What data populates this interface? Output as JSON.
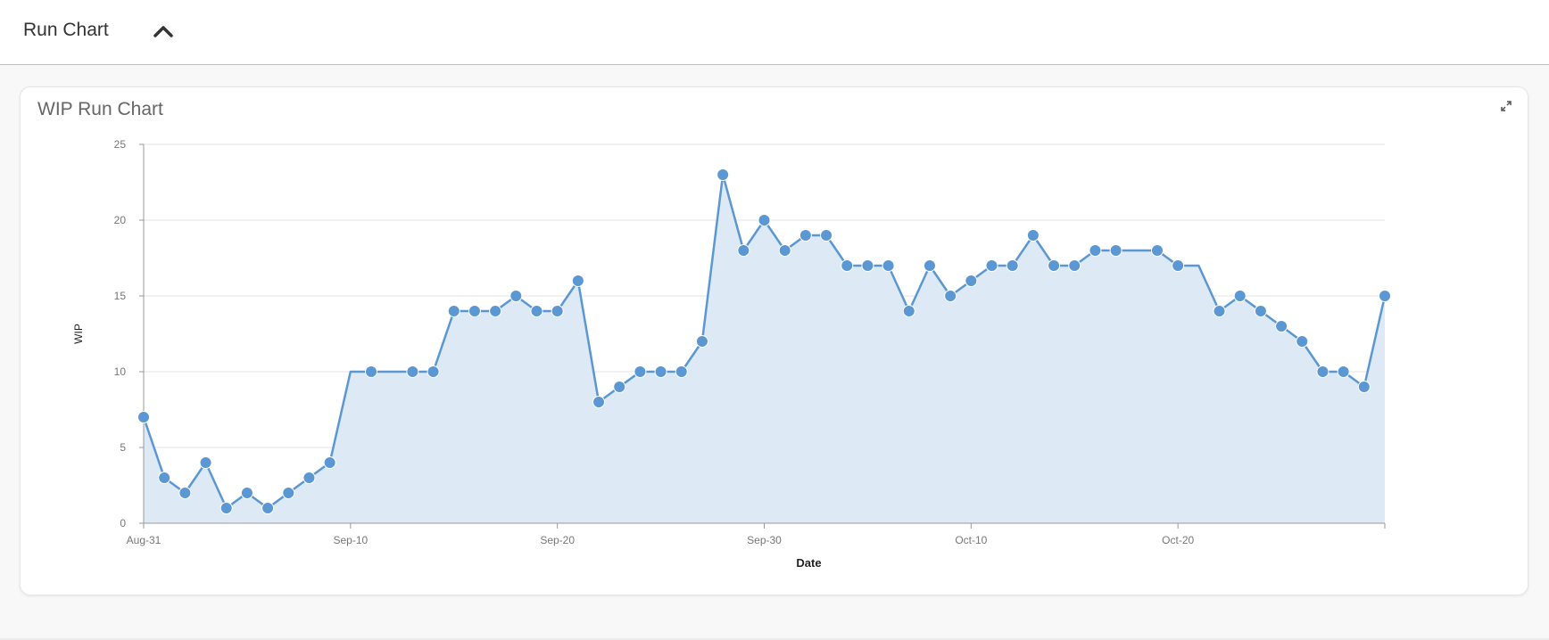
{
  "header": {
    "title": "Run Chart"
  },
  "card": {
    "title": "WIP Run Chart"
  },
  "colors": {
    "line": "#5b97d3",
    "fill": "#dde9f5",
    "grid": "#e3e3e3",
    "axis": "#999999"
  },
  "icons": {
    "collapse": "chevron-up-icon",
    "expand": "expand-icon"
  },
  "chart_data": {
    "type": "area",
    "title": "",
    "xlabel": "Date",
    "ylabel": "WIP",
    "ylim": [
      0,
      25
    ],
    "yticks": [
      0,
      5,
      10,
      15,
      20,
      25
    ],
    "grid": true,
    "xticks": [
      {
        "day": 0,
        "label": "Aug-31"
      },
      {
        "day": 10,
        "label": "Sep-10"
      },
      {
        "day": 20,
        "label": "Sep-20"
      },
      {
        "day": 30,
        "label": "Sep-30"
      },
      {
        "day": 40,
        "label": "Oct-10"
      },
      {
        "day": 50,
        "label": "Oct-20"
      }
    ],
    "series": [
      {
        "x": [
          "Aug-31",
          "Sep-01",
          "Sep-02",
          "Sep-03",
          "Sep-04",
          "Sep-05",
          "Sep-06",
          "Sep-07",
          "Sep-08",
          "Sep-09",
          "Sep-10",
          "Sep-11",
          "Sep-12",
          "Sep-13",
          "Sep-14",
          "Sep-15",
          "Sep-16",
          "Sep-17",
          "Sep-18",
          "Sep-19",
          "Sep-20",
          "Sep-21",
          "Sep-22",
          "Sep-23",
          "Sep-24",
          "Sep-25",
          "Sep-26",
          "Sep-27",
          "Sep-28",
          "Sep-29",
          "Sep-30",
          "Oct-01",
          "Oct-02",
          "Oct-03",
          "Oct-04",
          "Oct-05",
          "Oct-06",
          "Oct-07",
          "Oct-08",
          "Oct-09",
          "Oct-10",
          "Oct-11",
          "Oct-12",
          "Oct-13",
          "Oct-14",
          "Oct-15",
          "Oct-16",
          "Oct-17",
          "Oct-18",
          "Oct-19",
          "Oct-20",
          "Oct-21",
          "Oct-22",
          "Oct-23",
          "Oct-24",
          "Oct-25",
          "Oct-26",
          "Oct-27",
          "Oct-28",
          "Oct-29",
          "Oct-30"
        ],
        "values": [
          7,
          3,
          2,
          4,
          1,
          2,
          1,
          2,
          3,
          4,
          10,
          10,
          10,
          10,
          10,
          14,
          14,
          14,
          15,
          14,
          14,
          16,
          8,
          9,
          10,
          10,
          10,
          12,
          23,
          18,
          20,
          18,
          19,
          19,
          17,
          17,
          17,
          14,
          17,
          15,
          16,
          17,
          17,
          19,
          17,
          17,
          18,
          18,
          18,
          18,
          17,
          17,
          14,
          15,
          14,
          13,
          12,
          10,
          10,
          9,
          15
        ],
        "markers": [
          true,
          true,
          true,
          true,
          true,
          true,
          true,
          true,
          true,
          true,
          false,
          true,
          false,
          true,
          true,
          true,
          true,
          true,
          true,
          true,
          true,
          true,
          true,
          true,
          true,
          true,
          true,
          true,
          true,
          true,
          true,
          true,
          true,
          true,
          true,
          true,
          true,
          true,
          true,
          true,
          true,
          true,
          true,
          true,
          true,
          true,
          true,
          true,
          false,
          true,
          true,
          false,
          true,
          true,
          true,
          true,
          true,
          true,
          true,
          true,
          true
        ]
      }
    ]
  }
}
